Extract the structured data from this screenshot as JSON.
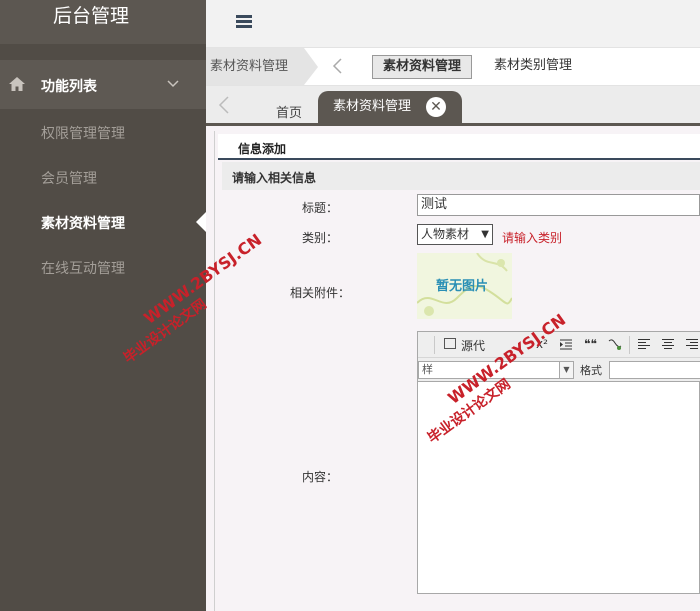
{
  "sidebar": {
    "brand": "后台管理",
    "menu_title": "功能列表",
    "items": [
      {
        "label": "权限管理管理"
      },
      {
        "label": "会员管理"
      },
      {
        "label": "素材资料管理"
      },
      {
        "label": "在线互动管理"
      }
    ]
  },
  "breadcrumb": {
    "main": "素材资料管理",
    "tabs": [
      "素材资料管理",
      "素材类别管理"
    ]
  },
  "tabbar": {
    "home": "首页",
    "current": "素材资料管理"
  },
  "form": {
    "panel_title": "信息添加",
    "section_title": "请输入相关信息",
    "title_label": "标题：",
    "title_value": "测试",
    "category_label": "类别：",
    "category_value": "人物素材",
    "category_hint": "请输入类别",
    "attachment_label": "相关附件：",
    "attachment_placeholder": "暂无图片",
    "content_label": "内容："
  },
  "editor": {
    "source_label": "源代",
    "superscript": "x²",
    "quote": "❝❝",
    "style_combo": "样",
    "format_label": "格式"
  },
  "watermark": {
    "url": "WWW.2BYSJ.CN",
    "site": "毕业设计论文网"
  },
  "colors": {
    "sidebar": "#514c46",
    "active_tab": "#5c5751",
    "hint": "#c8212a",
    "watermark": "#c8212a"
  }
}
